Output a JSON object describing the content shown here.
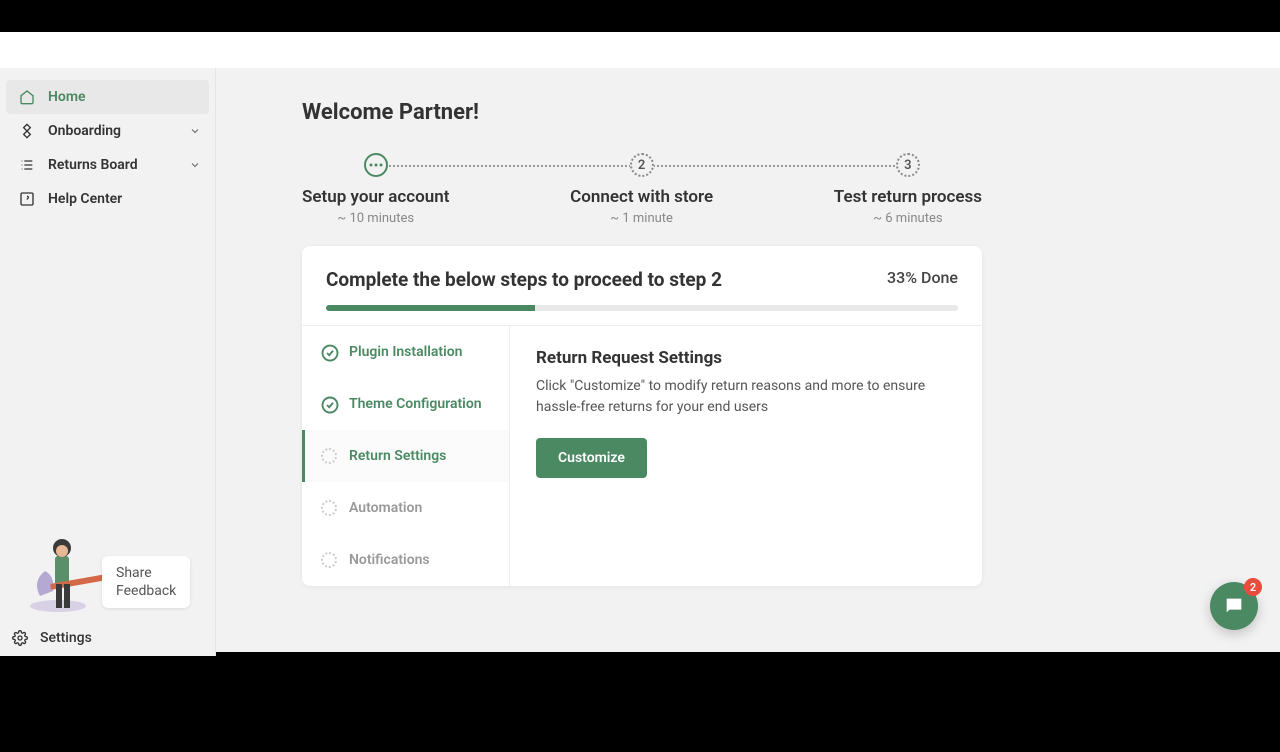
{
  "sidebar": {
    "items": [
      {
        "label": "Home"
      },
      {
        "label": "Onboarding"
      },
      {
        "label": "Returns Board"
      },
      {
        "label": "Help Center"
      }
    ],
    "feedback_line1": "Share",
    "feedback_line2": "Feedback",
    "settings": "Settings"
  },
  "main": {
    "welcome": "Welcome Partner!",
    "steps": [
      {
        "num": "⋯",
        "label": "Setup your account",
        "time": "~ 10 minutes"
      },
      {
        "num": "2",
        "label": "Connect with store",
        "time": "~ 1 minute"
      },
      {
        "num": "3",
        "label": "Test return process",
        "time": "~ 6 minutes"
      }
    ],
    "card_title": "Complete the below steps to proceed to step 2",
    "progress_percent": 33,
    "progress_label": "33% Done",
    "checklist": [
      {
        "label": "Plugin Installation",
        "state": "done"
      },
      {
        "label": "Theme Configuration",
        "state": "done"
      },
      {
        "label": "Return Settings",
        "state": "doing"
      },
      {
        "label": "Automation",
        "state": "todo"
      },
      {
        "label": "Notifications",
        "state": "todo"
      }
    ],
    "detail": {
      "title": "Return Request Settings",
      "desc": "Click \"Customize\" to modify return reasons and more to ensure hassle-free returns for your end users",
      "button": "Customize"
    }
  },
  "chat": {
    "badge": "2"
  }
}
